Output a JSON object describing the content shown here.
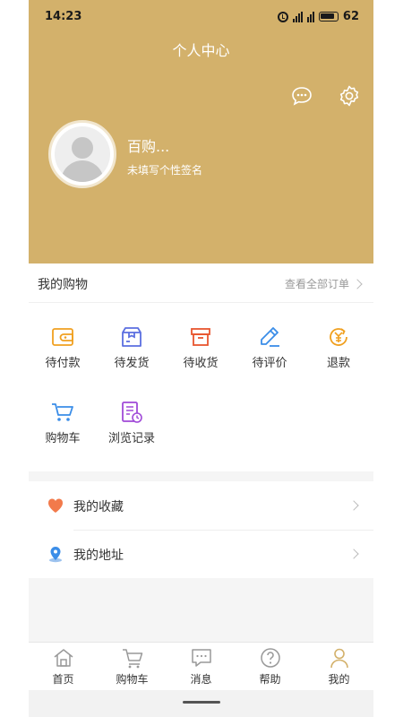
{
  "status": {
    "time": "14:23",
    "battery": "62"
  },
  "header": {
    "title": "个人中心"
  },
  "profile": {
    "name": "百购...",
    "signature": "未填写个性签名"
  },
  "shopping": {
    "title": "我的购物",
    "all_orders": "查看全部订单",
    "items": [
      {
        "label": "待付款",
        "icon": "wallet-icon"
      },
      {
        "label": "待发货",
        "icon": "box-icon"
      },
      {
        "label": "待收货",
        "icon": "package-icon"
      },
      {
        "label": "待评价",
        "icon": "pen-icon"
      },
      {
        "label": "退款",
        "icon": "refund-icon"
      },
      {
        "label": "购物车",
        "icon": "cart-icon"
      },
      {
        "label": "浏览记录",
        "icon": "history-icon"
      }
    ]
  },
  "list": [
    {
      "label": "我的收藏",
      "icon": "heart-icon"
    },
    {
      "label": "我的地址",
      "icon": "location-icon"
    }
  ],
  "tabs": [
    {
      "label": "首页",
      "icon": "home-icon"
    },
    {
      "label": "购物车",
      "icon": "cart-icon"
    },
    {
      "label": "消息",
      "icon": "message-icon"
    },
    {
      "label": "帮助",
      "icon": "help-icon"
    },
    {
      "label": "我的",
      "icon": "user-icon",
      "active": true
    }
  ],
  "colors": {
    "brand": "#d3b16b",
    "active_tab": "#d3b16b"
  }
}
